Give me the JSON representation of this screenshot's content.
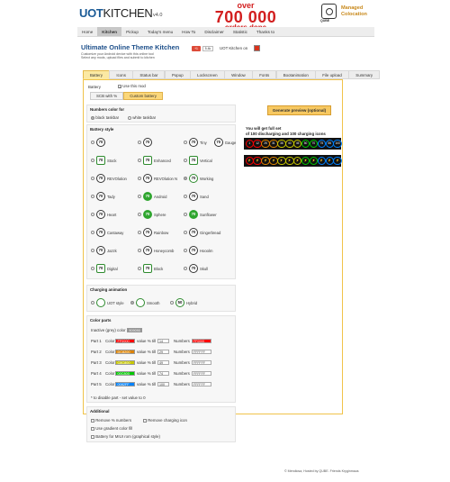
{
  "header": {
    "logo_bold": "UOT",
    "logo_rest": "KITCHEN",
    "version": "v4.0",
    "counter_over": "over",
    "counter_number": "700 000",
    "counter_orders": "orders done",
    "hosting_brand": "QUBE",
    "hosting_line1": "Managed",
    "hosting_line2": "Colocation"
  },
  "nav": {
    "items": [
      "Home",
      "Kitchen",
      "Pickup",
      "Today's menu",
      "How To",
      "Disclaimer",
      "Statistic",
      "Thanks to"
    ],
    "active": 1
  },
  "intro": {
    "title": "Ultimate Online Theme Kitchen",
    "line1": "Customize your Android device with this online tool",
    "line2": "Select any mods, upload files and submit to kitchen",
    "gplus_label": "+1",
    "gplus_count": "5.4k",
    "fb_label": "UOT Kitchen on"
  },
  "tabs": {
    "items": [
      "Battery",
      "Icons",
      "Status bar",
      "Popup",
      "Lockscreen",
      "Window",
      "Fonts",
      "Bootanimation",
      "File upload",
      "Summary"
    ],
    "active": 0
  },
  "battery": {
    "label": "Battery",
    "use_mod": "Use this mod",
    "subtabs": [
      "SCB with %",
      "Custom battery"
    ],
    "numbers_color_title": "Numbers color for",
    "numbers_color_opts": [
      "black taskbar",
      "white taskbar"
    ],
    "style_title": "Battery style",
    "styles": [
      [
        "Default",
        "Stock",
        "REVOlution",
        "Tady",
        "Heart",
        "Castaway",
        "Jazzk",
        "Digital"
      ],
      [
        "Circle",
        "Enhanced",
        "REVOlution N",
        "Android",
        "Sphere",
        "Rainbow",
        "Honeycomb",
        "Block"
      ],
      [
        "Tiny",
        "Vertical",
        "Working",
        "Sand",
        "Sunflower",
        "Gingerbread",
        "Hooolm",
        "Skull"
      ]
    ],
    "style_labels_shown": [
      [
        "",
        "Stock",
        "REVOlution",
        "Tady",
        "Heart",
        "Castaway",
        "Jazzk",
        "Digital"
      ],
      [
        "",
        "Enhanced",
        "REVOlution N",
        "Android",
        "Sphere",
        "Rainbow",
        "Honeycomb",
        "Block"
      ],
      [
        "Tiny",
        "Vertical",
        "Working",
        "Sand",
        "Sunflower",
        "Gingerbread",
        "Hooolm",
        "Skull"
      ]
    ],
    "gauge_label": "Gauge",
    "icon_number": "70",
    "charging_title": "Charging animation",
    "charging_opts": [
      "UOT style",
      "Smooth",
      "Hybrid"
    ],
    "charging_icon_number": "50",
    "color_parts_title": "Color parts",
    "inactive_label": "Inactive (grey) color",
    "inactive_value": "909090",
    "parts": [
      {
        "label": "Part 1",
        "color": "FF0000",
        "till": "14",
        "numbers": "FF0000",
        "numbers_color": "#ff0000"
      },
      {
        "label": "Part 2",
        "color": "DC8200",
        "till": "29",
        "numbers": "FFFFFF",
        "numbers_color": ""
      },
      {
        "label": "Part 3",
        "color": "C8C800",
        "till": "49",
        "numbers": "FFFFFF",
        "numbers_color": ""
      },
      {
        "label": "Part 4",
        "color": "00C800",
        "till": "74",
        "numbers": "FFFFFF",
        "numbers_color": ""
      },
      {
        "label": "Part 5",
        "color": "0082FF",
        "till": "100",
        "numbers": "FFFFFF",
        "numbers_color": ""
      }
    ],
    "color_word": "Color",
    "value_word": "value % till",
    "numbers_word": "Numbers",
    "disable_note": "* to disable part - set value to 0",
    "additional_title": "Additional",
    "additional_opts": [
      "Remove % numbers",
      "Remove charging icon",
      "Use gradient color fill",
      "Battery for MIUI rom (graphical style)"
    ]
  },
  "preview": {
    "button": "Generate preview (optional)",
    "line1": "You will get full set",
    "line2": "of 100 discharging and 100 charging icons",
    "discharge_numbers": [
      "1",
      "12",
      "25",
      "31",
      "38",
      "40",
      "45",
      "50",
      "70",
      "75",
      "85",
      "100"
    ],
    "colors": [
      "#ff0000",
      "#ff0000",
      "#dc8200",
      "#dc8200",
      "#c8c800",
      "#c8c800",
      "#c8c800",
      "#00c800",
      "#00c800",
      "#0082ff",
      "#0082ff",
      "#0082ff"
    ]
  },
  "footer": "© Mendiosa, Hosted by QUBE. Friends Kryginmaus"
}
